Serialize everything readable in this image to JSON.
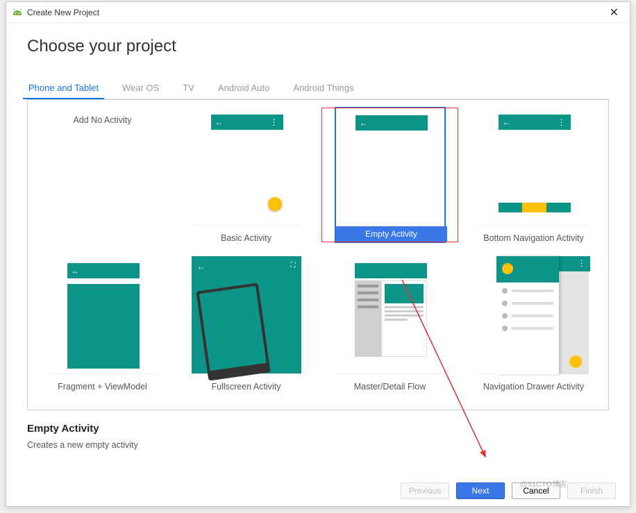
{
  "titlebar": {
    "title": "Create New Project"
  },
  "heading": "Choose your project",
  "tabs": [
    {
      "label": "Phone and Tablet",
      "active": true
    },
    {
      "label": "Wear OS",
      "active": false
    },
    {
      "label": "TV",
      "active": false
    },
    {
      "label": "Android Auto",
      "active": false
    },
    {
      "label": "Android Things",
      "active": false
    }
  ],
  "templates": [
    {
      "name": "Add No Activity"
    },
    {
      "name": "Basic Activity"
    },
    {
      "name": "Empty Activity",
      "selected": true,
      "label_in_thumb": "Empty Activity"
    },
    {
      "name": "Bottom Navigation Activity"
    },
    {
      "name": "Fragment + ViewModel"
    },
    {
      "name": "Fullscreen Activity"
    },
    {
      "name": "Master/Detail Flow"
    },
    {
      "name": "Navigation Drawer Activity"
    }
  ],
  "selection": {
    "title": "Empty Activity",
    "description": "Creates a new empty activity"
  },
  "footer": {
    "previous": "Previous",
    "next": "Next",
    "cancel": "Cancel",
    "finish": "Finish"
  },
  "watermark": "@51CTO博客",
  "colors": {
    "teal": "#0c9488",
    "accent": "#ffc107",
    "primary_blue": "#3b78e7",
    "highlight_red": "#e03030"
  }
}
